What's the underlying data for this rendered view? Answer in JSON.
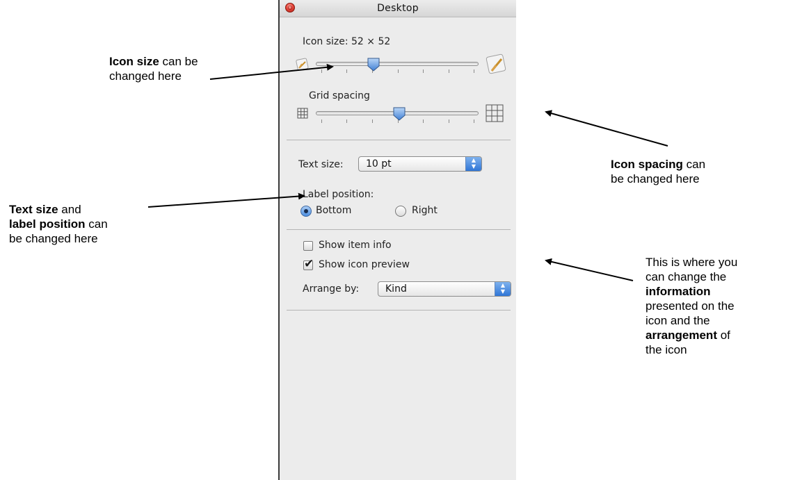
{
  "window": {
    "title": "Desktop"
  },
  "icon_size": {
    "label": "Icon size: 52 × 52",
    "slider_level": 0.4
  },
  "grid_spacing": {
    "label": "Grid spacing",
    "slider_level": 0.5
  },
  "text_size": {
    "label": "Text size:",
    "value": "10 pt"
  },
  "label_position": {
    "label": "Label position:",
    "options": [
      "Bottom",
      "Right"
    ],
    "selected": "Bottom"
  },
  "show_item_info": {
    "label": "Show item info",
    "checked": false
  },
  "show_icon_preview": {
    "label": "Show icon preview",
    "checked": true
  },
  "arrange_by": {
    "label": "Arrange by:",
    "value": "Kind"
  },
  "annotations": {
    "icon_size": {
      "bold": "Icon size",
      "rest1": " can be",
      "line2": "changed here"
    },
    "icon_spacing": {
      "bold": "Icon spacing",
      "rest1": " can",
      "line2": "be changed here"
    },
    "text_size": {
      "bold1": "Text size",
      "rest1": " and",
      "bold2": "label position",
      "rest2": " can",
      "line3": "be changed here"
    },
    "info": {
      "line1": "This is where you",
      "line2": "can change the",
      "bold1": "information",
      "line4": "presented on the",
      "line5": "icon and the",
      "bold2": "arrangement",
      "rest6": " of",
      "line7": "the icon"
    }
  }
}
